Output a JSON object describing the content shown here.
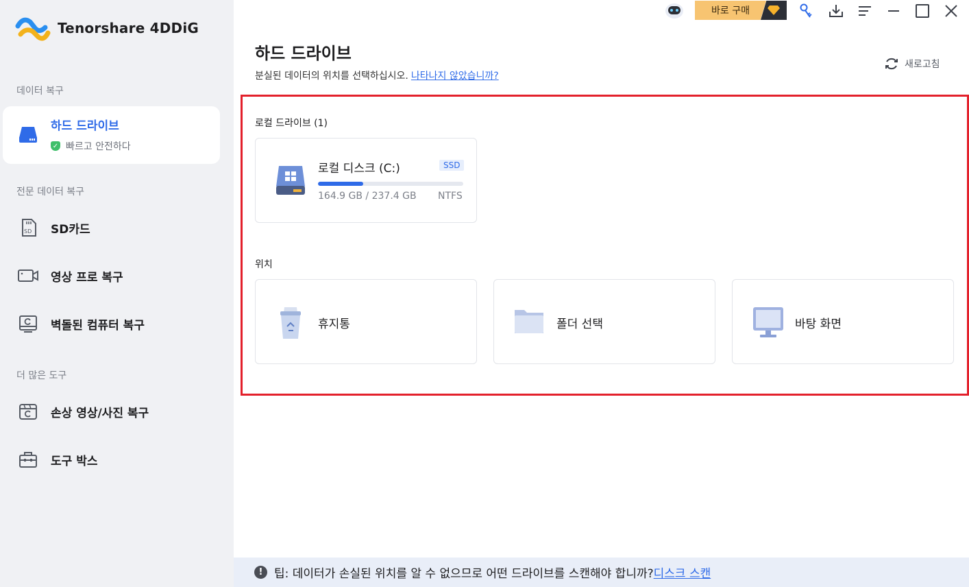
{
  "app": {
    "title": "Tenorshare 4DDiG"
  },
  "topbar": {
    "buy_label": "바로 구매"
  },
  "sidebar": {
    "sections": [
      {
        "title": "데이터 복구"
      },
      {
        "title": "전문 데이터 복구"
      },
      {
        "title": "더 많은 도구"
      }
    ],
    "active_item": {
      "label": "하드 드라이브",
      "sub": "빠르고 안전하다"
    },
    "items": [
      {
        "label": "SD카드",
        "icon": "sd-card-icon"
      },
      {
        "label": "영상 프로 복구",
        "icon": "video-camera-icon"
      },
      {
        "label": "벽돌된 컴퓨터 복구",
        "icon": "computer-icon"
      },
      {
        "label": "손상 영상/사진 복구",
        "icon": "photo-repair-icon"
      },
      {
        "label": "도구 박스",
        "icon": "toolbox-icon"
      }
    ]
  },
  "main": {
    "title": "하드 드라이브",
    "subtitle": "분실된 데이터의 위치를 선택하십시오.",
    "subtitle_link": "나타나지 않았습니까?",
    "refresh_label": "새로고침",
    "local_drives_label": "로컬 드라이브 (1)",
    "drives": [
      {
        "name": "로컬 디스크 (C:)",
        "type": "SSD",
        "used": "164.9 GB",
        "total": "237.4 GB",
        "size_text": "164.9 GB / 237.4 GB",
        "fs": "NTFS",
        "usage_fraction": 0.31
      }
    ],
    "locations_label": "위치",
    "locations": [
      {
        "label": "휴지통",
        "icon": "recycle-bin-icon"
      },
      {
        "label": "폴더 선택",
        "icon": "folder-icon"
      },
      {
        "label": "바탕 화면",
        "icon": "desktop-icon"
      }
    ]
  },
  "tip": {
    "text": "팁: 데이터가 손실된 위치를 알 수 없으므로 어떤 드라이브를 스캔해야 합니까?",
    "link": "디스크 스캔"
  },
  "colors": {
    "accent": "#2f6be8",
    "highlight_border": "#e3202b",
    "buy_button": "#f7c471"
  }
}
